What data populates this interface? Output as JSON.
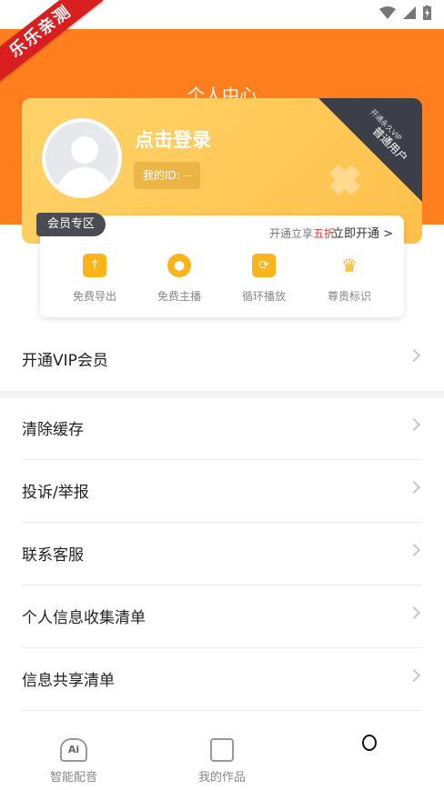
{
  "watermark": "乐乐亲测",
  "header": {
    "title": "个人中心"
  },
  "profile": {
    "login_text": "点击登录",
    "user_id": "我的ID: --",
    "user_type": "普通用户",
    "user_type_sub": "开通永久VIP"
  },
  "vip": {
    "badge": "会员专区",
    "promo_prefix": "开通立享",
    "promo_hot": "五折",
    "open_label": "立即开通 >",
    "items": [
      {
        "icon": "export-icon",
        "label": "免费导出"
      },
      {
        "icon": "anchor-icon",
        "label": "免费主播"
      },
      {
        "icon": "loop-icon",
        "label": "循环播放"
      },
      {
        "icon": "crown-icon",
        "label": "尊贵标识"
      }
    ]
  },
  "menu": {
    "vip": "开通VIP会员",
    "items": [
      "清除缓存",
      "投诉/举报",
      "联系客服",
      "个人信息收集清单",
      "信息共享清单"
    ]
  },
  "tabbar": {
    "tabs": [
      {
        "icon": "ai-dubbing-icon",
        "label": "智能配音"
      },
      {
        "icon": "works-icon",
        "label": "我的作品"
      }
    ]
  },
  "colors": {
    "primary": "#ff7f1f",
    "accent": "#ffb31a",
    "hot": "#e53935"
  }
}
